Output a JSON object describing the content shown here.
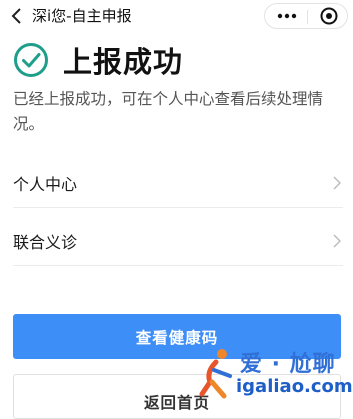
{
  "navbar": {
    "title": "深i您-自主申报",
    "icons": {
      "back": "chevron-left-icon",
      "more": "more-dots-icon",
      "close": "target-close-icon"
    }
  },
  "result": {
    "title": "上报成功",
    "description": "已经上报成功，可在个人中心查看后续处理情况。",
    "icon": "check-circle-icon",
    "accent_color": "#1f9e8a"
  },
  "menu": {
    "items": [
      {
        "label": "个人中心"
      },
      {
        "label": "联合义诊"
      }
    ]
  },
  "buttons": {
    "primary_label": "查看健康码",
    "primary_color": "#3e8ef7",
    "secondary_label": "返回首页"
  },
  "watermark": {
    "cn": "爱 · 尬聊",
    "en": "igaliao.com"
  }
}
